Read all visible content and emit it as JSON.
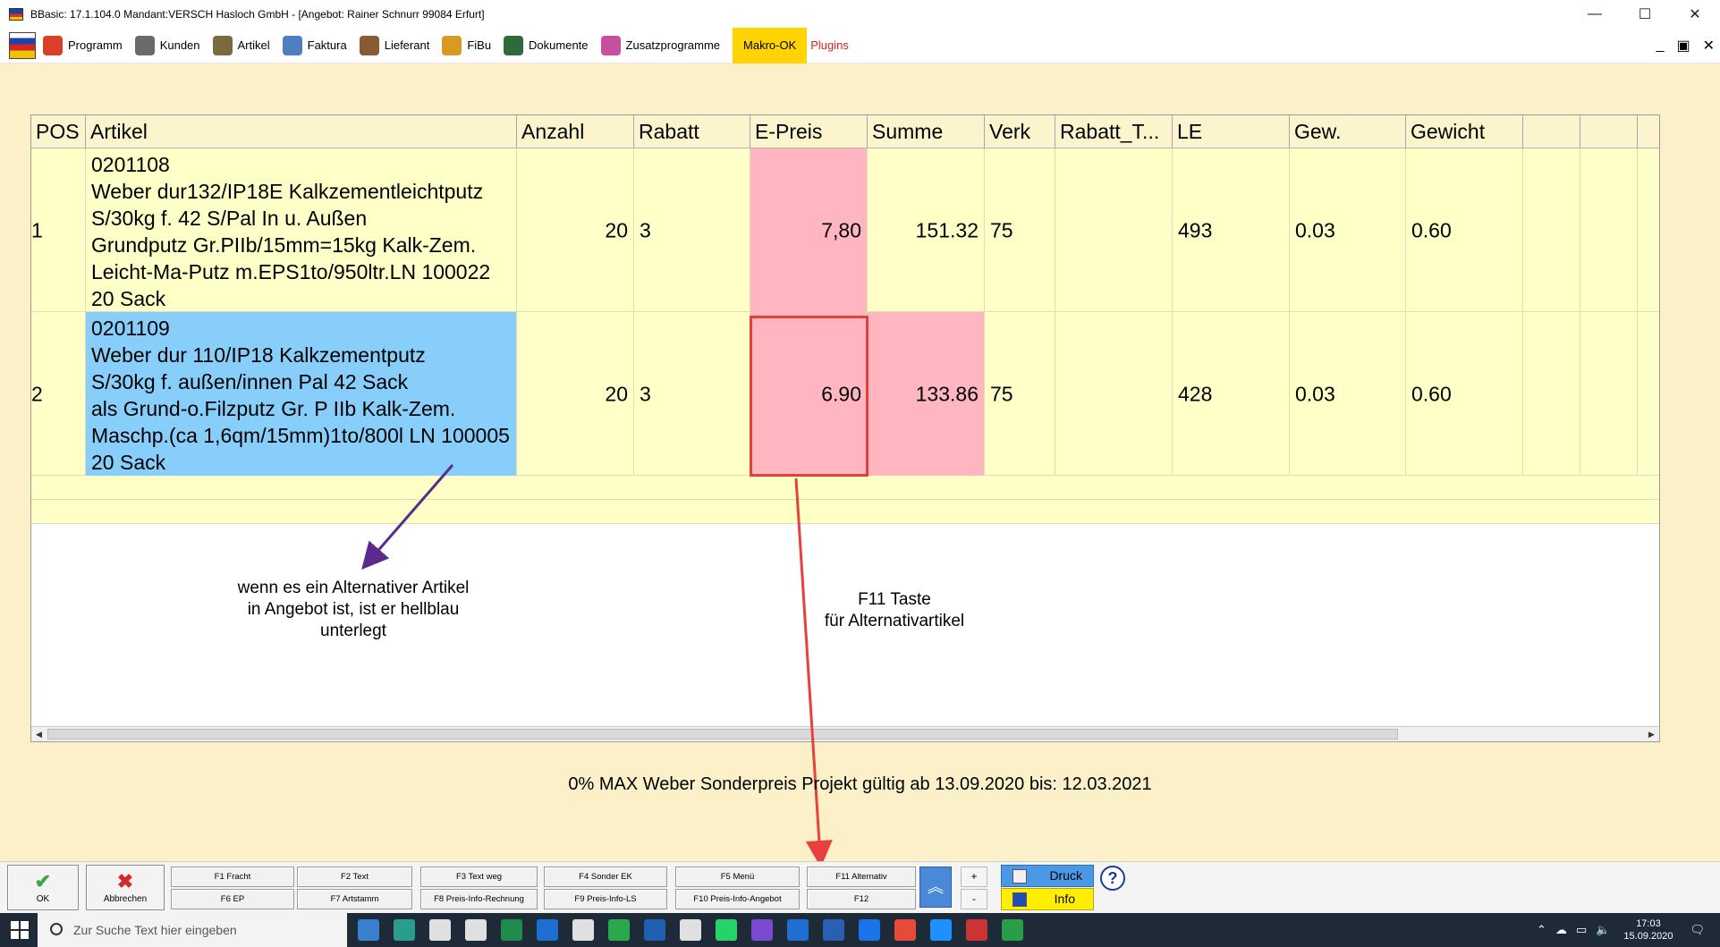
{
  "window": {
    "title": "BBasic: 17.1.104.0 Mandant:VERSCH Hasloch GmbH  - [Angebot: Rainer Schnurr 99084 Erfurt]",
    "controls": [
      "—",
      "☐",
      "✕"
    ]
  },
  "menu": {
    "items": [
      {
        "label": "Programm",
        "color": "#d8402a"
      },
      {
        "label": "Kunden",
        "color": "#6a6a6a"
      },
      {
        "label": "Artikel",
        "color": "#7a6a40"
      },
      {
        "label": "Faktura",
        "color": "#4f7fc0"
      },
      {
        "label": "Lieferant",
        "color": "#8a5a30"
      },
      {
        "label": "FiBu",
        "color": "#d89a20"
      },
      {
        "label": "Dokumente",
        "color": "#2e6a3a"
      },
      {
        "label": "Zusatzprogramme",
        "color": "#c64fa0"
      }
    ],
    "makro_label": "Makro-OK",
    "plugins_label": "Plugins",
    "mdi_controls": [
      "_",
      "▣",
      "✕"
    ]
  },
  "grid": {
    "columns": [
      "POS",
      "Artikel",
      "Anzahl",
      "Rabatt",
      "E-Preis",
      "Summe",
      "Verk",
      "Rabatt_T...",
      "LE",
      "Gew.",
      "Gewicht",
      "",
      ""
    ],
    "rows": [
      {
        "pos": "1",
        "artikel_lines": [
          "0201108",
          "Weber dur132/IP18E Kalkzementleichtputz",
          "S/30kg f. 42 S/Pal In u. Außen",
          "Grundputz Gr.PIIb/15mm=15kg Kalk-Zem.",
          "Leicht-Ma-Putz m.EPS1to/950ltr.LN 100022",
          "20 Sack"
        ],
        "anzahl": "20",
        "rabatt": "3",
        "epreis": "7,80",
        "summe": "151.32",
        "verk": "75",
        "rabatt_t": "",
        "le": "493",
        "gew": "0.03",
        "gewicht": "0.60"
      },
      {
        "pos": "2",
        "artikel_lines": [
          "0201109",
          "Weber dur 110/IP18  Kalkzementputz",
          "S/30kg f. außen/innen Pal 42 Sack",
          "als Grund-o.Filzputz Gr. P IIb Kalk-Zem.",
          "Maschp.(ca 1,6qm/15mm)1to/800l LN 100005",
          "20 Sack"
        ],
        "anzahl": "20",
        "rabatt": "3",
        "epreis": "6.90",
        "summe": "133.86",
        "verk": "75",
        "rabatt_t": "",
        "le": "428",
        "gew": "0.03",
        "gewicht": "0.60"
      }
    ]
  },
  "annotations": {
    "left_note": [
      "wenn es ein Alternativer Artikel",
      "in Angebot ist, ist er hellblau",
      "unterlegt"
    ],
    "right_note": [
      "F11 Taste",
      "für Alternativartikel"
    ]
  },
  "status_text": "0% MAX Weber   Sonderpreis Projekt gültig ab 13.09.2020 bis: 12.03.2021",
  "buttons": {
    "ok": "OK",
    "cancel": "Abbrechen",
    "fkeys_top": [
      "F1 Fracht",
      "F2 Text",
      "F3 Text weg",
      "F4 Sonder EK",
      "F5 Menü",
      "F11 Alternativ"
    ],
    "fkeys_bottom": [
      "F6 EP",
      "F7 Artstamm",
      "F8 Preis-Info-Rechnung",
      "F9 Preis-Info-LS",
      "F10 Preis-Info-Angebot",
      "F12"
    ],
    "plus": "+",
    "minus": "-",
    "druck": "Druck",
    "info": "Info",
    "help": "?"
  },
  "taskbar": {
    "search_placeholder": "Zur Suche Text hier eingeben",
    "time": "17:03",
    "date": "15.09.2020",
    "app_icons": [
      "#3a7fd0",
      "#2a9d8f",
      "#e0e0e0",
      "#e0e0e0",
      "#1f8c4d",
      "#1d6fd0",
      "#e0e0e0",
      "#2aa84a",
      "#2060b0",
      "#e0e0e0",
      "#25d366",
      "#7a4bd0",
      "#1e6fd0",
      "#2b5eb5",
      "#1a73e8",
      "#e84a3a",
      "#1e90ff",
      "#cc3333",
      "#2a9d48"
    ]
  }
}
